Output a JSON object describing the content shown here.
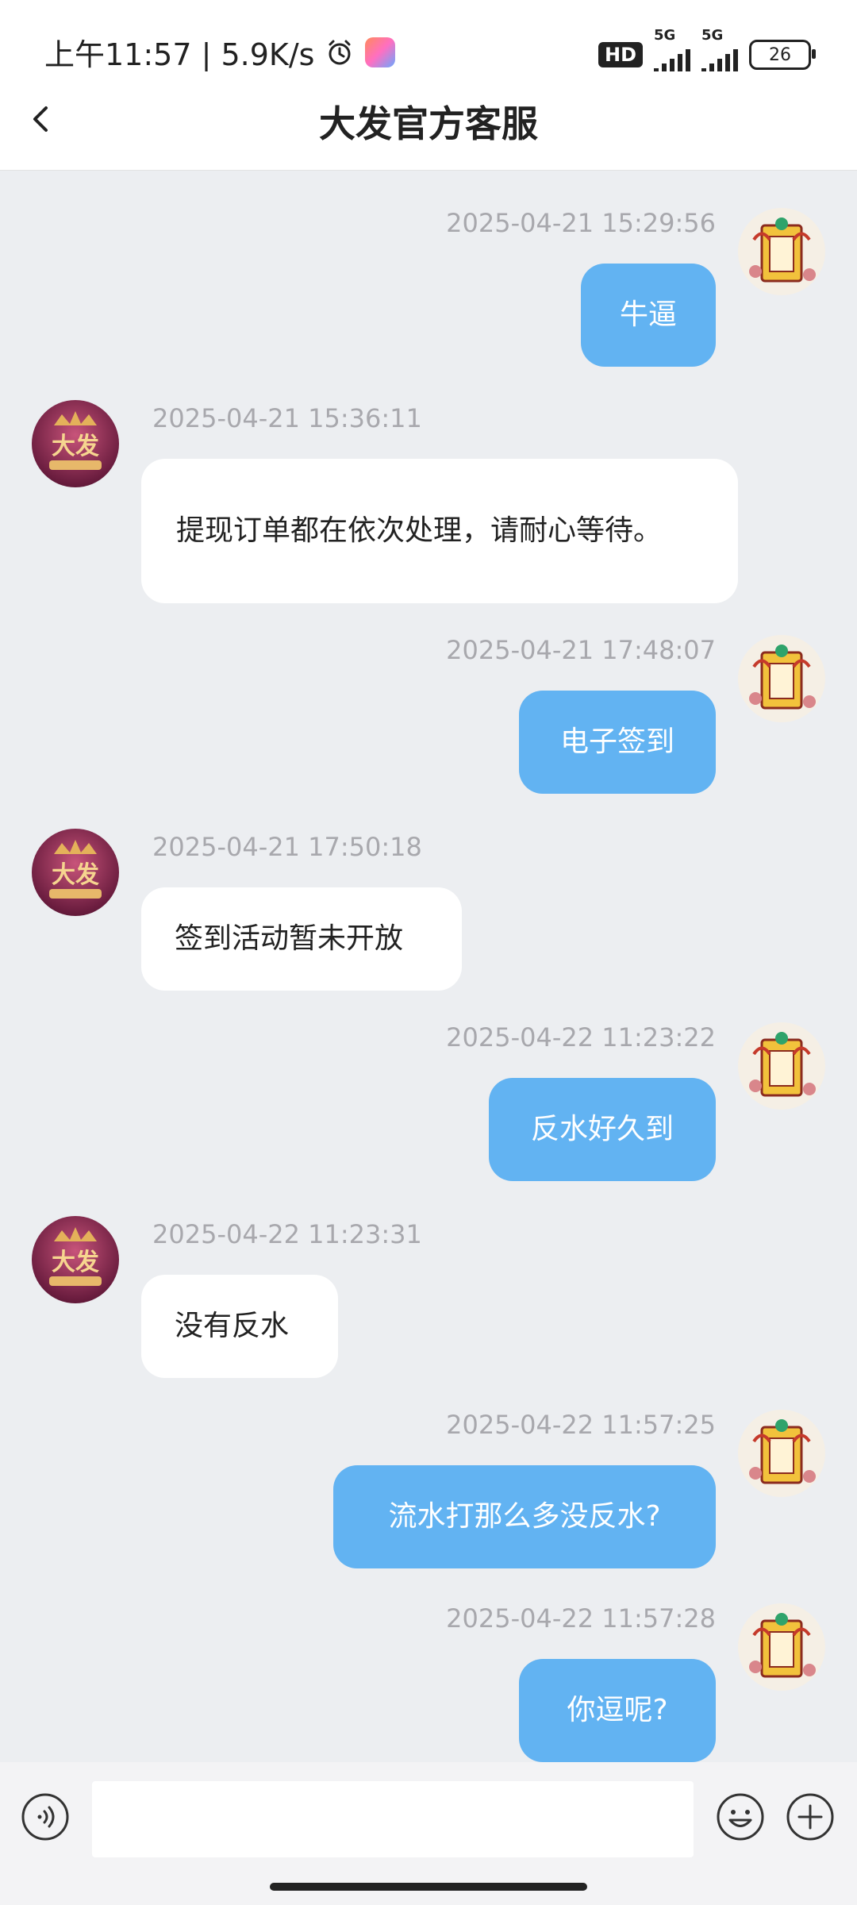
{
  "status_bar": {
    "time_speed": "上午11:57 | 5.9K/s",
    "hd_label": "HD",
    "net1": "5G",
    "net2": "5G",
    "battery": "26"
  },
  "header": {
    "title": "大发官方客服"
  },
  "messages": [
    {
      "side": "out",
      "timestamp": "2025-04-21 15:29:56",
      "text": "牛逼"
    },
    {
      "side": "in",
      "timestamp": "2025-04-21 15:36:11",
      "text": " 提现订单都在依次处理，请耐心等待。"
    },
    {
      "side": "out",
      "timestamp": "2025-04-21 17:48:07",
      "text": "电子签到"
    },
    {
      "side": "in",
      "timestamp": "2025-04-21 17:50:18",
      "text": "签到活动暂未开放"
    },
    {
      "side": "out",
      "timestamp": "2025-04-22 11:23:22",
      "text": "反水好久到"
    },
    {
      "side": "in",
      "timestamp": "2025-04-22 11:23:31",
      "text": "没有反水"
    },
    {
      "side": "out",
      "timestamp": "2025-04-22 11:57:25",
      "text": "流水打那么多没反水?"
    },
    {
      "side": "out",
      "timestamp": "2025-04-22 11:57:28",
      "text": "你逗呢?"
    }
  ],
  "input": {
    "value": "",
    "placeholder": ""
  },
  "icons": {
    "back": "chevron-left-icon",
    "voice": "voice-icon",
    "emoji": "emoji-icon",
    "plus": "plus-icon"
  }
}
